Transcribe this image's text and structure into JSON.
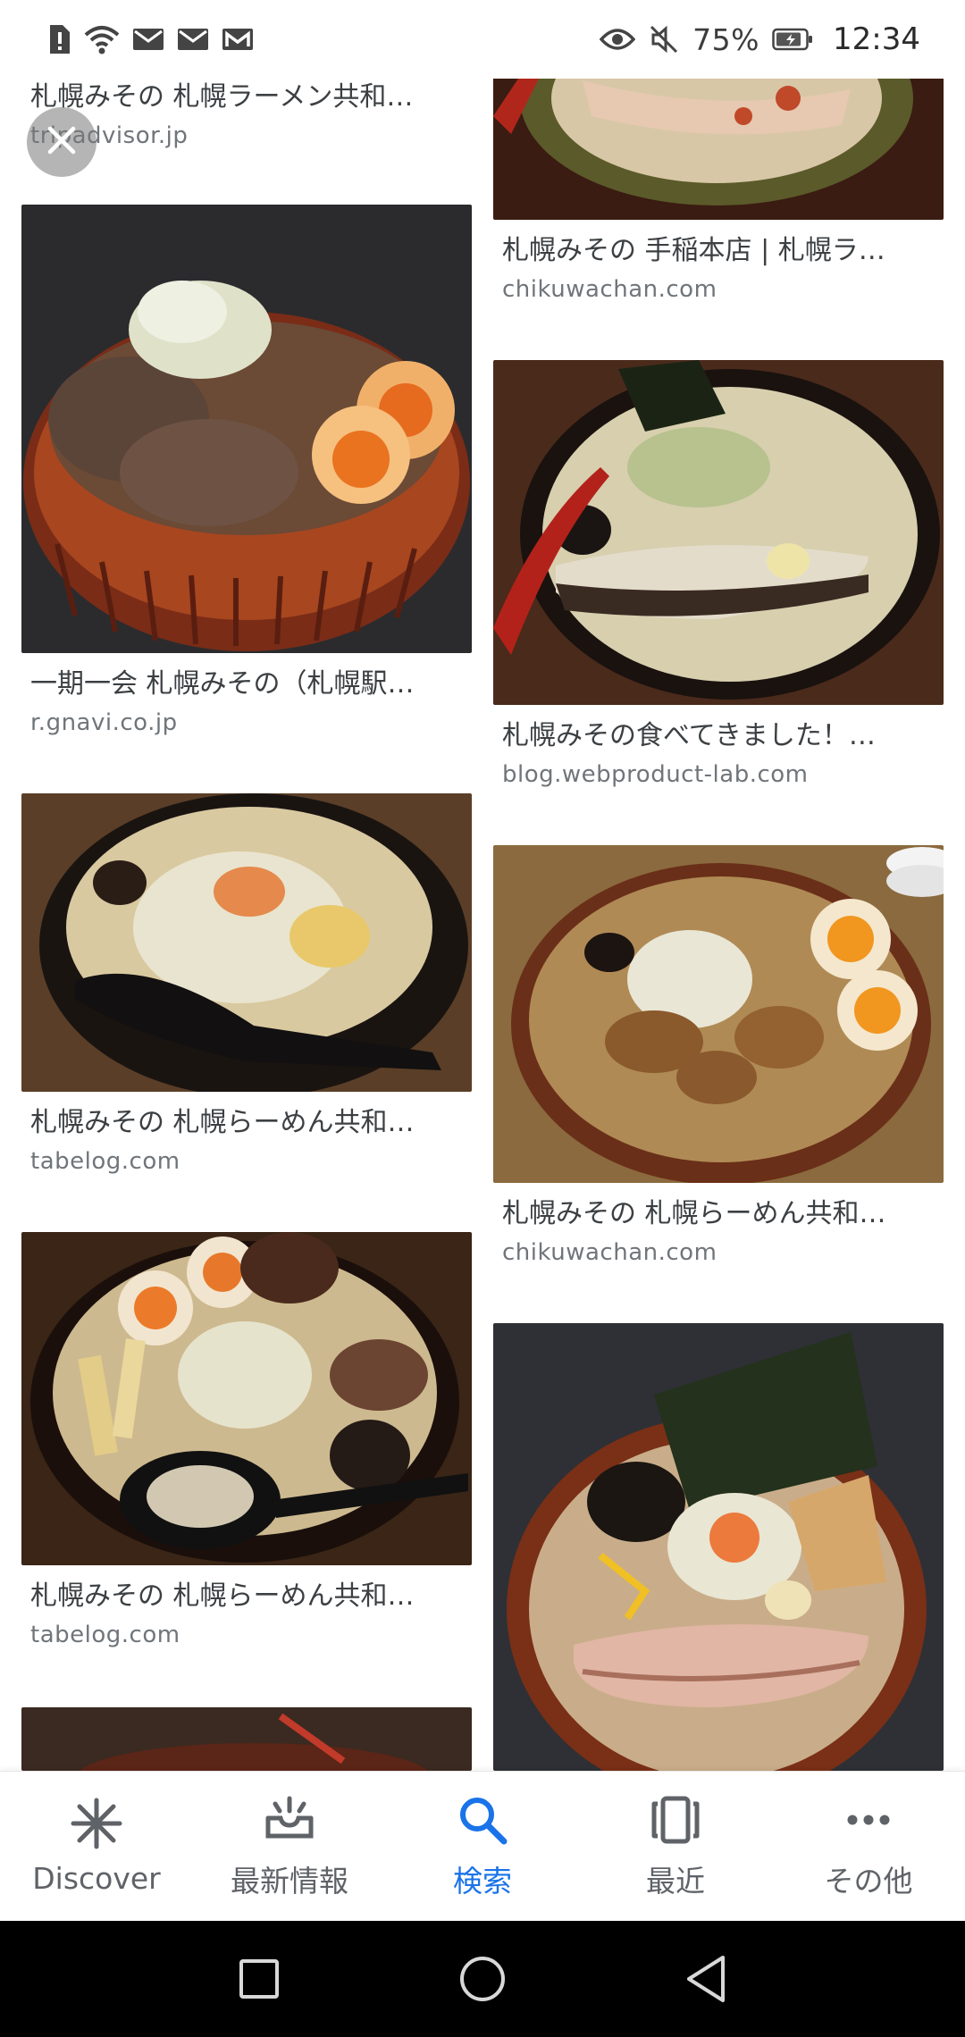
{
  "status_bar": {
    "battery": "75%",
    "time": "12:34"
  },
  "results": {
    "left": [
      {
        "title": "札幌みその 札幌ラーメン共和…",
        "source": "tripadvisor.jp"
      },
      {
        "title": "一期一会 札幌みその（札幌駅…",
        "source": "r.gnavi.co.jp"
      },
      {
        "title": "札幌みその 札幌らーめん共和…",
        "source": "tabelog.com"
      },
      {
        "title": "札幌みその 札幌らーめん共和…",
        "source": "tabelog.com"
      }
    ],
    "right": [
      {
        "title": "札幌みその 手稲本店 | 札幌ラ…",
        "source": "chikuwachan.com"
      },
      {
        "title": "札幌みその食べてきました！…",
        "source": "blog.webproduct-lab.com"
      },
      {
        "title": "札幌みその 札幌らーめん共和…",
        "source": "chikuwachan.com"
      }
    ]
  },
  "bottom_nav": {
    "items": [
      {
        "label": "Discover",
        "icon": "asterisk-icon"
      },
      {
        "label": "最新情報",
        "icon": "updates-icon"
      },
      {
        "label": "検索",
        "icon": "search-icon",
        "active": true
      },
      {
        "label": "最近",
        "icon": "recent-icon"
      },
      {
        "label": "その他",
        "icon": "more-icon"
      }
    ]
  },
  "colors": {
    "accent": "#1a73e8",
    "text_secondary": "#70757a",
    "text_primary": "#3c4043"
  }
}
